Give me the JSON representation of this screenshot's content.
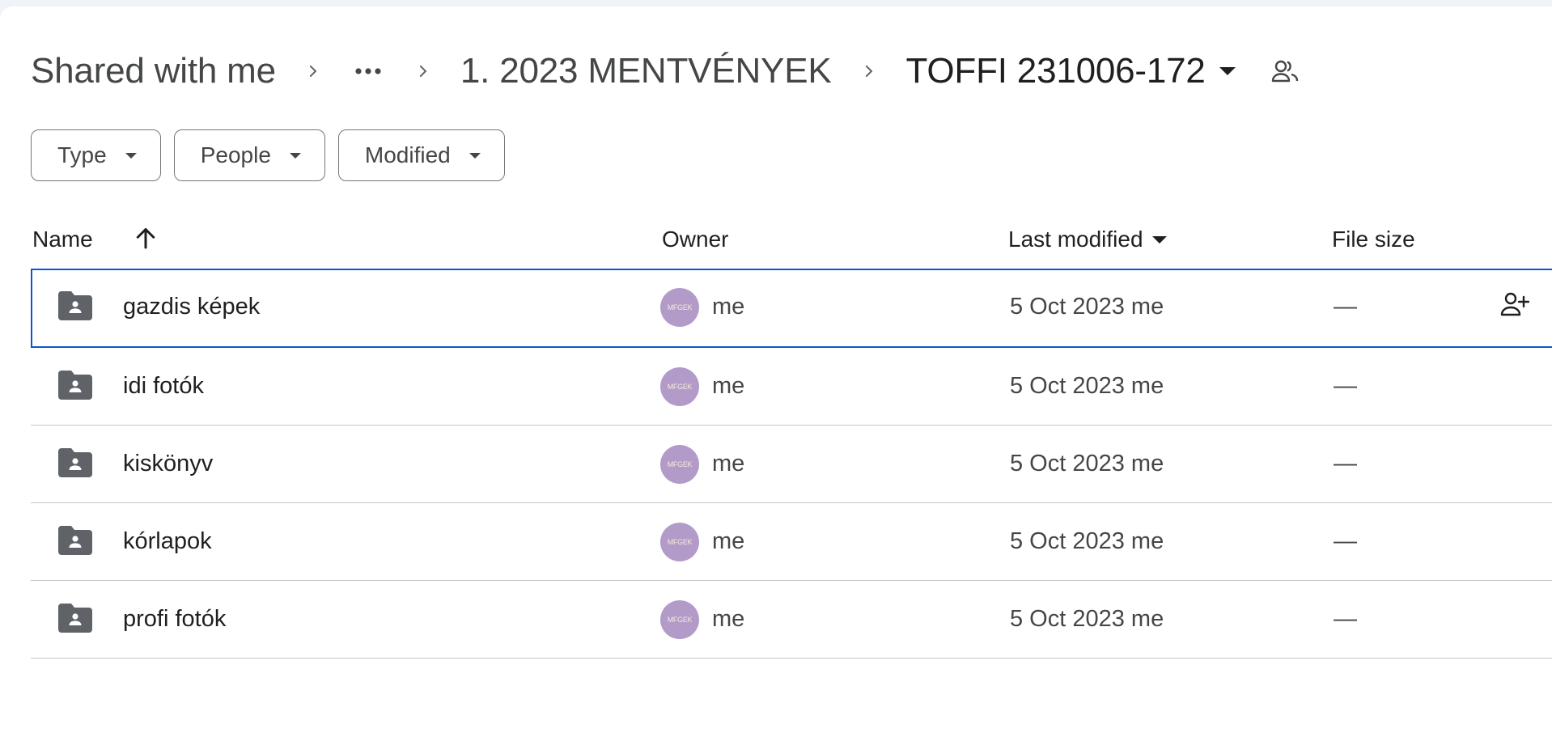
{
  "breadcrumb": {
    "root": "Shared with me",
    "more_icon": "more-horiz-icon",
    "parent": "1. 2023 MENTVÉNYEK",
    "current": "TOFFI 231006-172",
    "chevron_icon": "chevron-right-icon",
    "share_icon": "people-icon"
  },
  "filters": {
    "type": "Type",
    "people": "People",
    "modified": "Modified"
  },
  "table": {
    "headers": {
      "name": "Name",
      "owner": "Owner",
      "last_modified": "Last modified",
      "file_size": "File size"
    },
    "sort_icon": "arrow-up-icon",
    "rows": [
      {
        "name": "gazdis képek",
        "avatar": "MFGEK",
        "owner": "me",
        "date": "5 Oct 2023  me",
        "size": "—",
        "selected": true,
        "hover_action": "add-person-icon"
      },
      {
        "name": "idi fotók",
        "avatar": "MFGEK",
        "owner": "me",
        "date": "5 Oct 2023  me",
        "size": "—"
      },
      {
        "name": "kiskönyv",
        "avatar": "MFGEK",
        "owner": "me",
        "date": "5 Oct 2023  me",
        "size": "—"
      },
      {
        "name": "kórlapok",
        "avatar": "MFGEK",
        "owner": "me",
        "date": "5 Oct 2023  me",
        "size": "—"
      },
      {
        "name": "profi fotók",
        "avatar": "MFGEK",
        "owner": "me",
        "date": "5 Oct 2023  me",
        "size": "—"
      }
    ]
  },
  "colors": {
    "selection_border": "#0b57d0",
    "avatar_bg": "#b29bc9",
    "folder_icon": "#5f6368",
    "divider": "#c7c7c7"
  }
}
